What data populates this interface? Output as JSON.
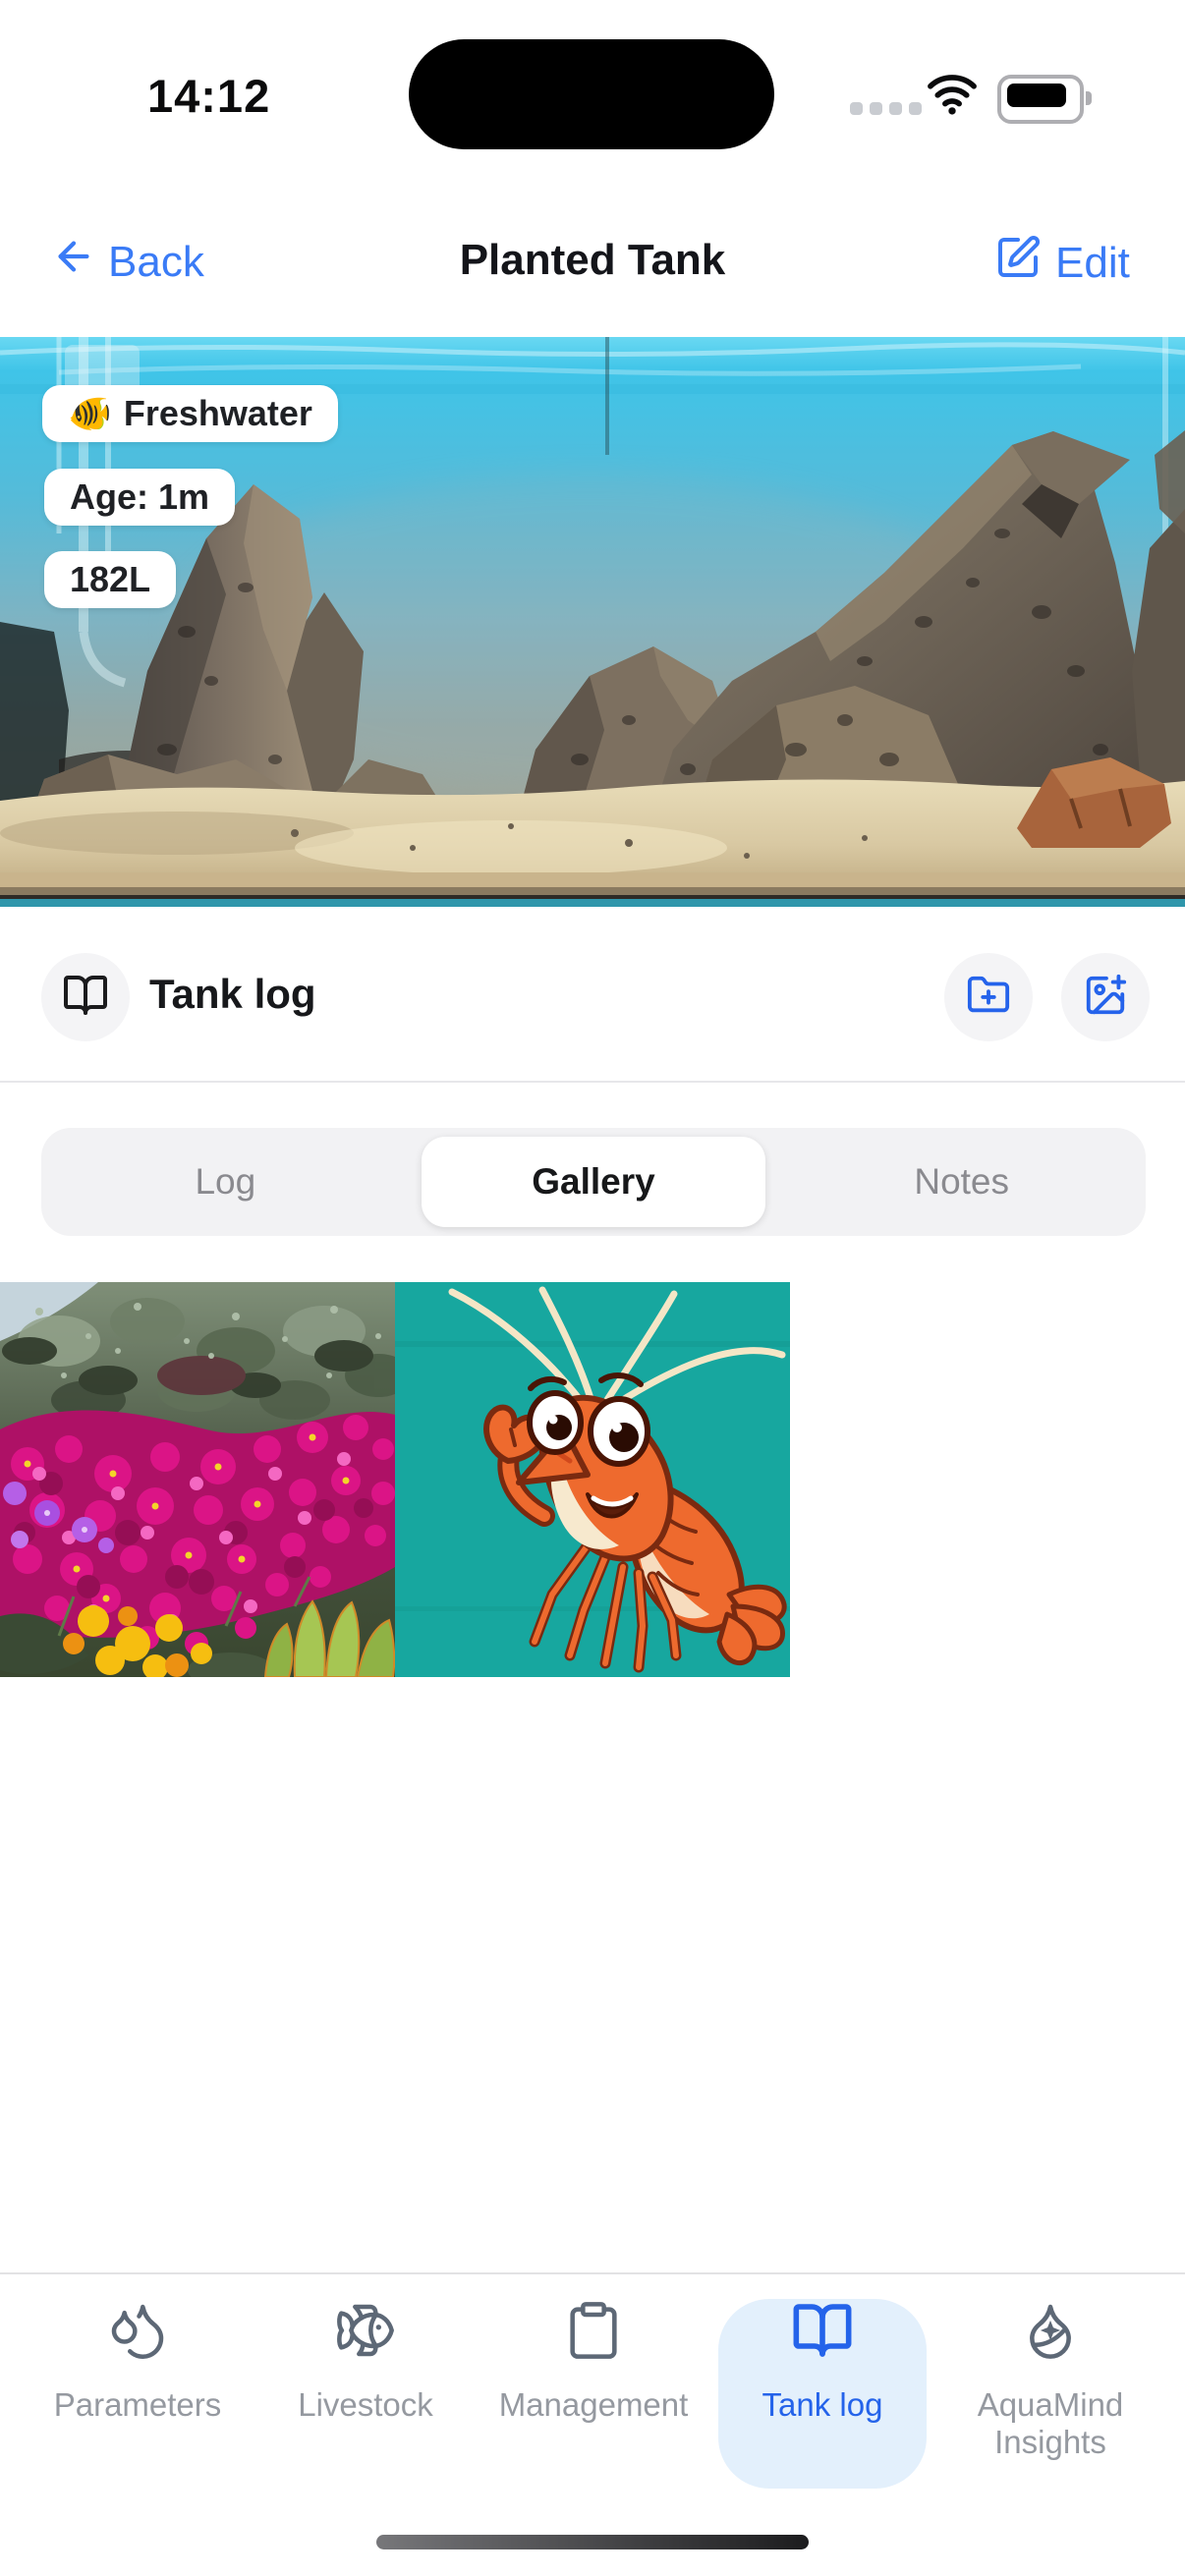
{
  "status_bar": {
    "time": "14:12"
  },
  "nav": {
    "back_label": "Back",
    "title": "Planted Tank",
    "edit_label": "Edit"
  },
  "hero": {
    "badges": [
      {
        "icon": "🐠",
        "label": "Freshwater"
      },
      {
        "label": "Age: 1m"
      },
      {
        "label": "182L"
      }
    ]
  },
  "section": {
    "title": "Tank log"
  },
  "segmented": {
    "items": [
      "Log",
      "Gallery",
      "Notes"
    ],
    "selected": "Gallery"
  },
  "gallery": {
    "items": [
      {
        "name": "flowers-photo"
      },
      {
        "name": "shrimp-illustration"
      }
    ]
  },
  "tab_bar": {
    "items": [
      {
        "label": "Parameters"
      },
      {
        "label": "Livestock"
      },
      {
        "label": "Management"
      },
      {
        "label": "Tank log"
      },
      {
        "label": "AquaMind Insights"
      }
    ],
    "active": "Tank log"
  },
  "colors": {
    "accent_blue": "#3a7bf6",
    "tab_active_blue": "#2463ea",
    "tab_active_bg": "#e3f0fc",
    "inactive_icon": "#5d6876",
    "inactive_label": "#9599a0",
    "segment_bg": "#f2f2f4",
    "shrimp_tile_bg": "#17a79f"
  }
}
